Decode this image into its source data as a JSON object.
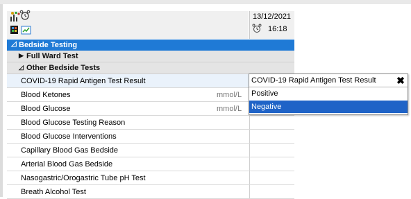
{
  "header": {
    "date": "13/12/2021",
    "time": "16:18",
    "icons": [
      "pin-chart-icon",
      "clock-alarm-icon",
      "document-color-icon",
      "chart-check-icon"
    ]
  },
  "tree": {
    "section": {
      "label": "Bedside Testing",
      "expanded": true
    },
    "groups": [
      {
        "label": "Full Ward Test",
        "expanded": false
      },
      {
        "label": "Other Bedside Tests",
        "expanded": true
      }
    ],
    "rows": [
      {
        "label": "COVID-19 Rapid Antigen Test Result",
        "unit": ""
      },
      {
        "label": "Blood Ketones",
        "unit": "mmol/L"
      },
      {
        "label": "Blood Glucose",
        "unit": "mmol/L"
      },
      {
        "label": "Blood Glucose Testing Reason",
        "unit": ""
      },
      {
        "label": "Blood Glucose Interventions",
        "unit": ""
      },
      {
        "label": "Capillary Blood Gas Bedside",
        "unit": ""
      },
      {
        "label": "Arterial Blood Gas Bedside",
        "unit": ""
      },
      {
        "label": "Nasogastric/Orogastric Tube pH Test",
        "unit": ""
      },
      {
        "label": "Breath Alcohol Test",
        "unit": ""
      }
    ]
  },
  "popup": {
    "title": "COVID-19 Rapid Antigen Test Result",
    "close_glyph": "✖",
    "options": [
      "Positive",
      "Negative"
    ],
    "selected": "Negative"
  },
  "colors": {
    "section_bg": "#1f7ad6",
    "selected_option_bg": "#1f63c7",
    "group_bg": "#e4e4e4"
  }
}
